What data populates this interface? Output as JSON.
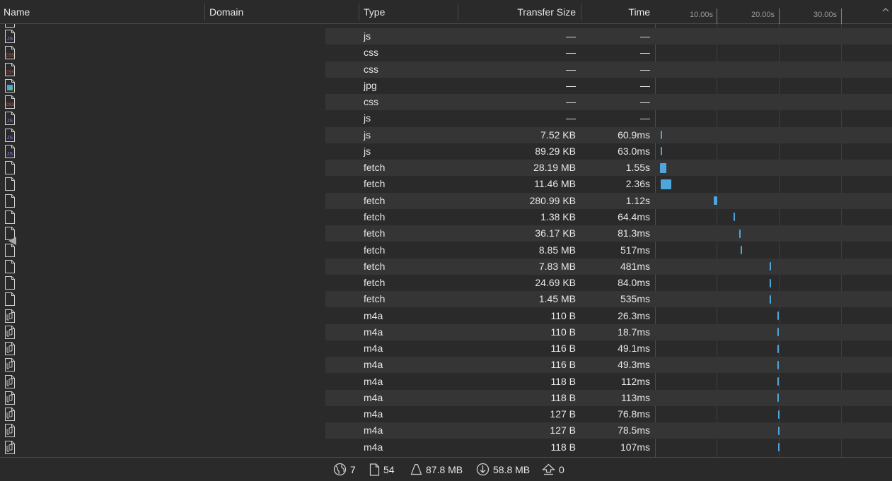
{
  "columns": {
    "name": "Name",
    "domain": "Domain",
    "type": "Type",
    "transfer_size": "Transfer Size",
    "time": "Time"
  },
  "timeline": {
    "ticks": [
      "10.00s",
      "20.00s",
      "30.00s"
    ],
    "bar_color": "#4ea6dc"
  },
  "rows": [
    {
      "icon": "js-file-icon",
      "type": "js",
      "size": "—",
      "time": "—"
    },
    {
      "icon": "css-file-icon",
      "type": "css",
      "size": "—",
      "time": "—"
    },
    {
      "icon": "css-file-icon",
      "type": "css",
      "size": "—",
      "time": "—"
    },
    {
      "icon": "image-file-icon",
      "type": "jpg",
      "size": "—",
      "time": "—"
    },
    {
      "icon": "css-file-icon",
      "type": "css",
      "size": "—",
      "time": "—"
    },
    {
      "icon": "js-file-icon",
      "type": "js",
      "size": "—",
      "time": "—"
    },
    {
      "icon": "js-file-icon",
      "type": "js",
      "size": "7.52 KB",
      "time": "60.9ms",
      "start_s": 0.9,
      "duration_s": 0.06
    },
    {
      "icon": "js-file-icon",
      "type": "js",
      "size": "89.29 KB",
      "time": "63.0ms",
      "start_s": 0.9,
      "duration_s": 0.063
    },
    {
      "icon": "generic-file-icon",
      "type": "fetch",
      "size": "28.19 MB",
      "time": "1.55s",
      "start_s": 0.8,
      "duration_s": 1.05
    },
    {
      "icon": "generic-file-icon",
      "type": "fetch",
      "size": "11.46 MB",
      "time": "2.36s",
      "start_s": 0.9,
      "duration_s": 1.7
    },
    {
      "icon": "generic-file-icon",
      "type": "fetch",
      "size": "280.99 KB",
      "time": "1.12s",
      "start_s": 9.5,
      "duration_s": 0.5
    },
    {
      "icon": "generic-file-icon",
      "type": "fetch",
      "size": "1.38 KB",
      "time": "64.4ms",
      "start_s": 12.6,
      "duration_s": 0.064
    },
    {
      "icon": "generic-file-icon",
      "type": "fetch",
      "size": "36.17 KB",
      "time": "81.3ms",
      "start_s": 13.6,
      "duration_s": 0.081
    },
    {
      "icon": "generic-file-icon",
      "type": "fetch",
      "size": "8.85 MB",
      "time": "517ms",
      "start_s": 13.8,
      "duration_s": 0.2
    },
    {
      "icon": "generic-file-icon",
      "type": "fetch",
      "size": "7.83 MB",
      "time": "481ms",
      "start_s": 18.4,
      "duration_s": 0.2
    },
    {
      "icon": "generic-file-icon",
      "type": "fetch",
      "size": "24.69 KB",
      "time": "84.0ms",
      "start_s": 18.4,
      "duration_s": 0.084
    },
    {
      "icon": "generic-file-icon",
      "type": "fetch",
      "size": "1.45 MB",
      "time": "535ms",
      "start_s": 18.4,
      "duration_s": 0.2
    },
    {
      "icon": "audio-file-icon",
      "type": "m4a",
      "size": "110 B",
      "time": "26.3ms",
      "start_s": 19.7,
      "duration_s": 0.05
    },
    {
      "icon": "audio-file-icon",
      "type": "m4a",
      "size": "110 B",
      "time": "18.7ms",
      "start_s": 19.7,
      "duration_s": 0.05
    },
    {
      "icon": "audio-file-icon",
      "type": "m4a",
      "size": "116 B",
      "time": "49.1ms",
      "start_s": 19.7,
      "duration_s": 0.05
    },
    {
      "icon": "audio-file-icon",
      "type": "m4a",
      "size": "116 B",
      "time": "49.3ms",
      "start_s": 19.7,
      "duration_s": 0.05
    },
    {
      "icon": "audio-file-icon",
      "type": "m4a",
      "size": "118 B",
      "time": "112ms",
      "start_s": 19.75,
      "duration_s": 0.05
    },
    {
      "icon": "audio-file-icon",
      "type": "m4a",
      "size": "118 B",
      "time": "113ms",
      "start_s": 19.75,
      "duration_s": 0.05
    },
    {
      "icon": "audio-file-icon",
      "type": "m4a",
      "size": "127 B",
      "time": "76.8ms",
      "start_s": 19.8,
      "duration_s": 0.05
    },
    {
      "icon": "audio-file-icon",
      "type": "m4a",
      "size": "127 B",
      "time": "78.5ms",
      "start_s": 19.8,
      "duration_s": 0.05
    },
    {
      "icon": "audio-file-icon",
      "type": "m4a",
      "size": "118 B",
      "time": "107ms",
      "start_s": 19.8,
      "duration_s": 0.05
    }
  ],
  "footer": {
    "domains": "7",
    "resources": "54",
    "size": "87.8 MB",
    "transferred": "58.8 MB",
    "errors": "0"
  }
}
